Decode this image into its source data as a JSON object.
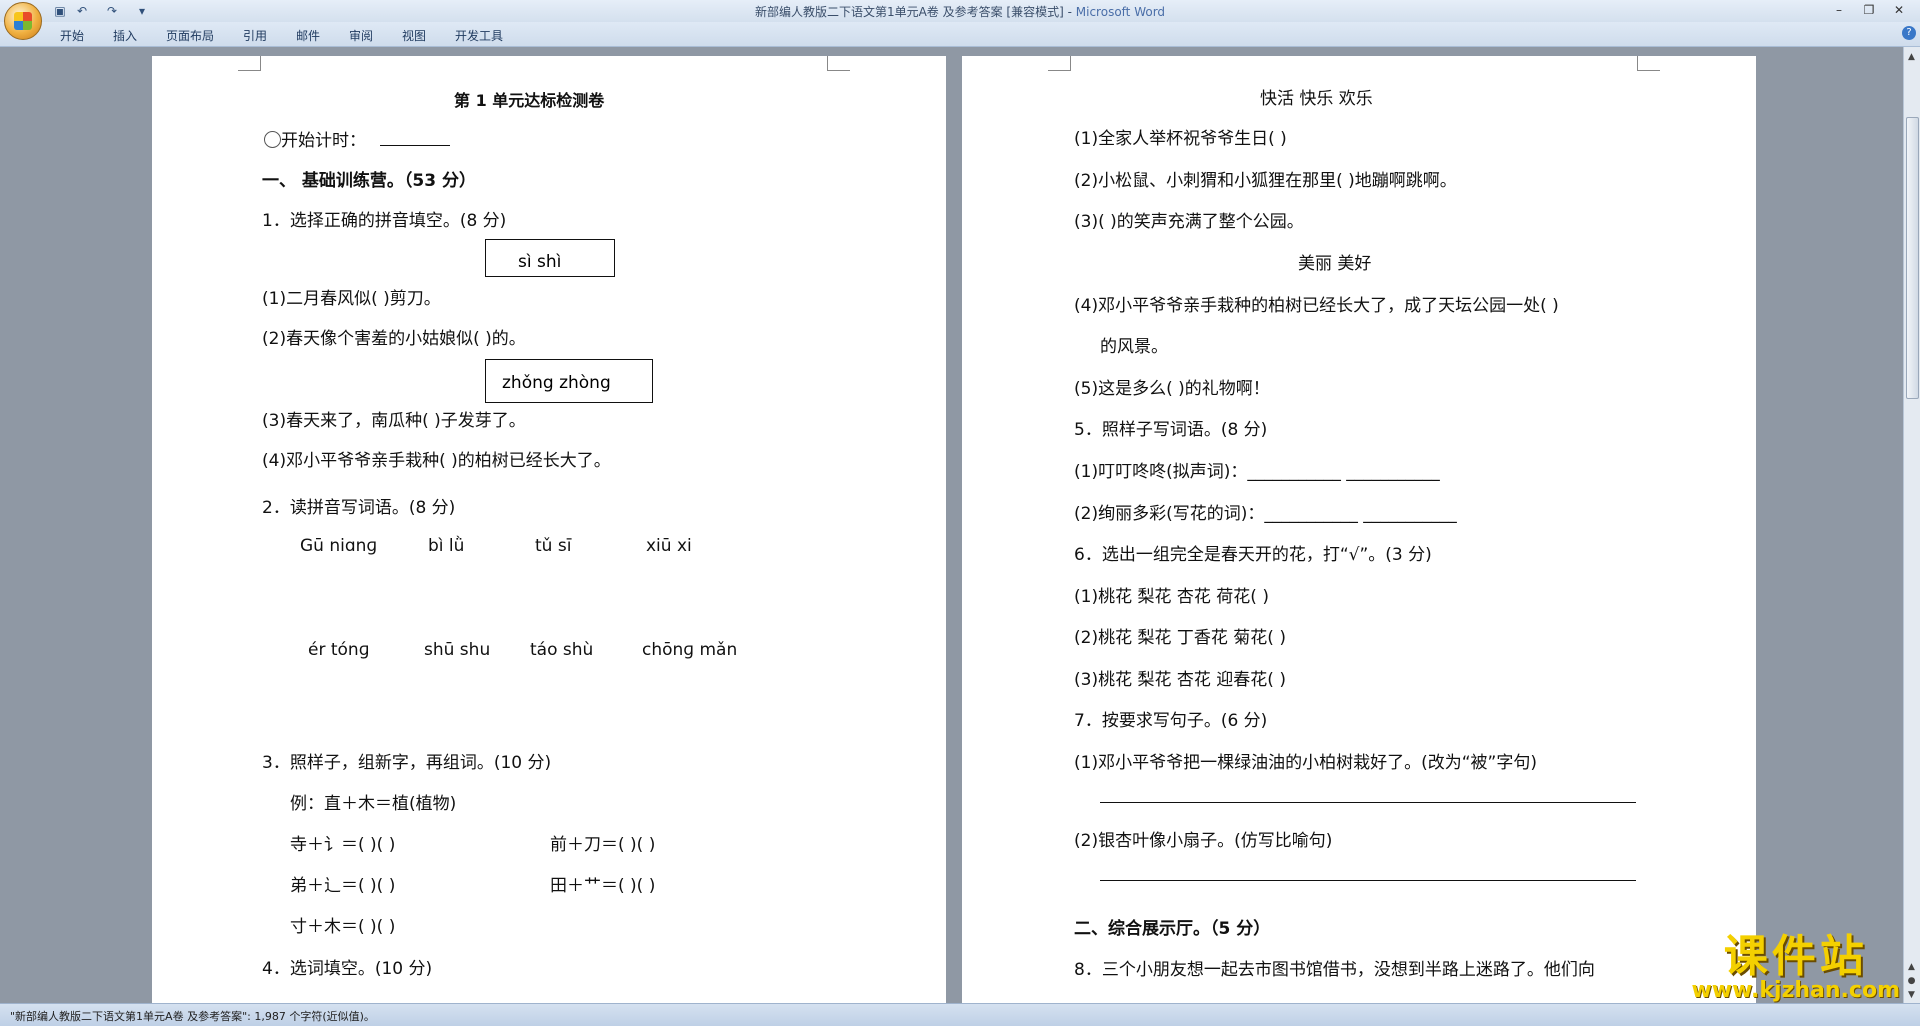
{
  "window": {
    "title": "新部编人教版二下语文第1单元A卷 及参考答案 [兼容模式] - ",
    "app": "Microsoft Word"
  },
  "ribbon_tabs": [
    "开始",
    "插入",
    "页面布局",
    "引用",
    "邮件",
    "审阅",
    "视图",
    "开发工具"
  ],
  "status_bar": "\"新部编人教版二下语文第1单元A卷 及参考答案\": 1,987 个字符(近似值)。",
  "watermark": {
    "main": "课件站",
    "url": "www.kjzhan.com"
  },
  "left_page": {
    "title": "第 1 单元达标检测卷",
    "start_time": "开始计时：",
    "sec1": "一、  基础训练营。（53 分）",
    "q1": "1．选择正确的拼音填空。(8 分)",
    "q1_box1": "sì     shì",
    "q1_1": "(1)二月春风似(    )剪刀。",
    "q1_2": "(2)春天像个害羞的小姑娘似(    )的。",
    "q1_box2": "zhǒng     zhòng",
    "q1_3": "(3)春天来了，南瓜种(    )子发芽了。",
    "q1_4": "(4)邓小平爷爷亲手栽种(    )的柏树已经长大了。",
    "q2": "2．读拼音写词语。(8 分)",
    "pinyin_row1": [
      "Gū  niɑnɡ",
      "bì  lǜ",
      "tǔ  sī",
      "xiū  xi"
    ],
    "pinyin_row2": [
      "ér  tónɡ",
      "shū shu",
      "táo shù",
      "chōnɡ  mǎn"
    ],
    "q3": "3．照样子，组新字，再组词。(10 分)",
    "q3_example": "例：直＋木＝植(植物)",
    "q3_rows": [
      [
        "寺＋讠＝(    )(        )",
        "前＋刀＝(    )(          )"
      ],
      [
        "弟＋⻌＝(    )(        )",
        "田＋艹＝(    )(          )"
      ],
      [
        "寸＋木＝(    )(        )",
        ""
      ]
    ],
    "q4": "4．选词填空。(10 分)"
  },
  "right_page": {
    "words1": "快活      快乐      欢乐",
    "r1": "(1)全家人举杯祝爷爷生日(      )",
    "r2": "(2)小松鼠、小刺猬和小狐狸在那里(    )地蹦啊跳啊。",
    "r3": "(3)(    )的笑声充满了整个公园。",
    "words2": "美丽      美好",
    "r4": "(4)邓小平爷爷亲手栽种的柏树已经长大了，成了天坛公园一处(      )",
    "r4b": "的风景。",
    "r5": "(5)这是多么(     )的礼物啊！",
    "q5": "5．照样子写词语。(8 分)",
    "q5_1": "(1)叮叮咚咚(拟声词)：___________     ___________",
    "q5_2": "(2)绚丽多彩(写花的词)：___________     ___________",
    "q6": "6．选出一组完全是春天开的花，打“√”。(3 分)",
    "q6_1": "(1)桃花   梨花   杏花   荷花(        )",
    "q6_2": "(2)桃花   梨花   丁香花   菊花(        )",
    "q6_3": "(3)桃花   梨花   杏花   迎春花(       )",
    "q7": "7．按要求写句子。(6 分)",
    "q7_1": "(1)邓小平爷爷把一棵绿油油的小柏树栽好了。(改为“被”字句)",
    "q7_2": "(2)银杏叶像小扇子。(仿写比喻句)",
    "sec2": "二、综合展示厅。（5 分）",
    "q8": "8．三个小朋友想一起去市图书馆借书，没想到半路上迷路了。他们向"
  }
}
